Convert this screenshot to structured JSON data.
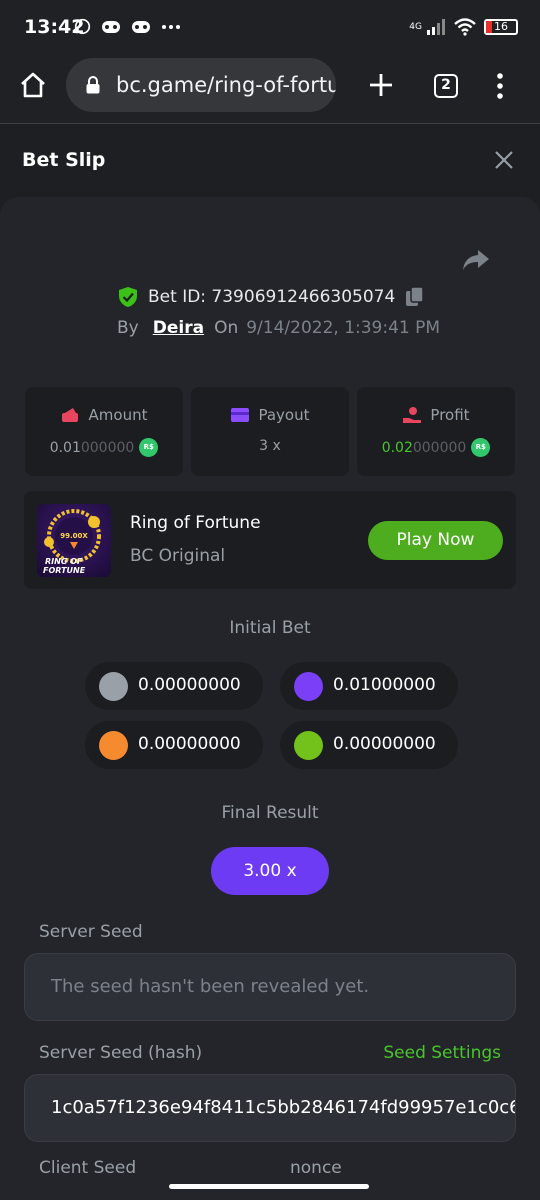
{
  "status_bar": {
    "time": "13:42",
    "network": "4G",
    "battery": "16"
  },
  "browser": {
    "url": "bc.game/ring-of-fortu",
    "tab_count": "2"
  },
  "panel": {
    "title": "Bet Slip"
  },
  "bet": {
    "id_label": "Bet ID: 73906912466305074",
    "by_label": "By",
    "user": "Deira",
    "on_label": "On",
    "date": "9/14/2022, 1:39:41 PM"
  },
  "stats": {
    "amount_label": "Amount",
    "amount_main": "0.01",
    "amount_dim": "000000",
    "payout_label": "Payout",
    "payout_value": "3 x",
    "profit_label": "Profit",
    "profit_main": "0.02",
    "profit_dim": "000000",
    "coin_symbol": "R$"
  },
  "game": {
    "name": "Ring of Fortune",
    "subtitle": "BC Original",
    "play_label": "Play Now",
    "thumb_multiplier": "99.00X",
    "thumb_title_line1": "RING OF",
    "thumb_title_line2": "FORTUNE"
  },
  "initial_bet": {
    "title": "Initial Bet",
    "items": [
      {
        "color": "#9aa0a8",
        "value": "0.00000000"
      },
      {
        "color": "#7b3ff7",
        "value": "0.01000000"
      },
      {
        "color": "#f68a2f",
        "value": "0.00000000"
      },
      {
        "color": "#72c21b",
        "value": "0.00000000"
      }
    ]
  },
  "final_result": {
    "title": "Final Result",
    "value": "3.00 x"
  },
  "server_seed": {
    "label": "Server Seed",
    "value": "The seed hasn't been revealed yet."
  },
  "server_seed_hash": {
    "label": "Server Seed (hash)",
    "settings_label": "Seed Settings",
    "value": "1c0a57f1236e94f8411c5bb2846174fd99957e1c0c6"
  },
  "client_seed": {
    "label": "Client Seed",
    "nonce_label": "nonce"
  }
}
